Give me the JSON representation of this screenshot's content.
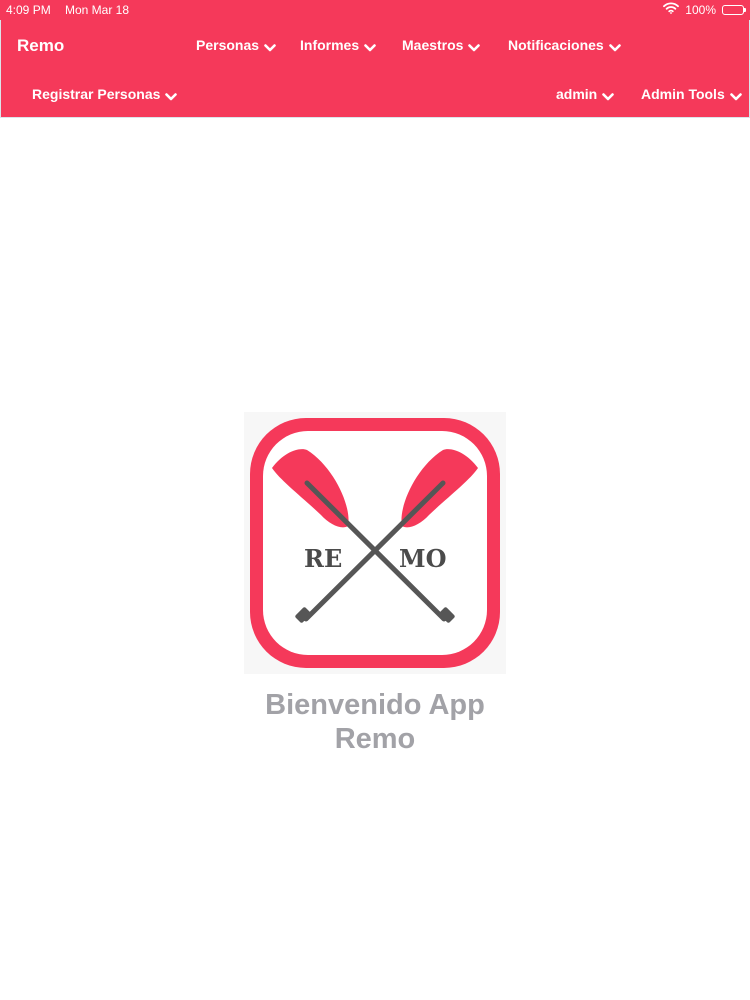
{
  "status_bar": {
    "time": "4:09 PM",
    "date": "Mon Mar 18",
    "battery": "100%",
    "icons": [
      "wifi-icon",
      "battery-icon"
    ]
  },
  "navbar": {
    "brand": "Remo",
    "items_row1": [
      "Personas",
      "Informes",
      "Maestros",
      "Notificaciones"
    ],
    "items_row2_left": [
      "Registrar Personas"
    ],
    "items_row2_right": [
      "admin",
      "Admin Tools"
    ],
    "chevron_icon": "chevron-down-icon",
    "background_color": "#f5395a"
  },
  "logo": {
    "text_left": "RE",
    "text_right": "MO",
    "frame_color": "#f5395a",
    "oar_color": "#565656",
    "blade_color": "#f5395a"
  },
  "main": {
    "welcome_line1": "Bienvenido App",
    "welcome_line2": "Remo",
    "welcome_color": "#a2a2a7"
  }
}
